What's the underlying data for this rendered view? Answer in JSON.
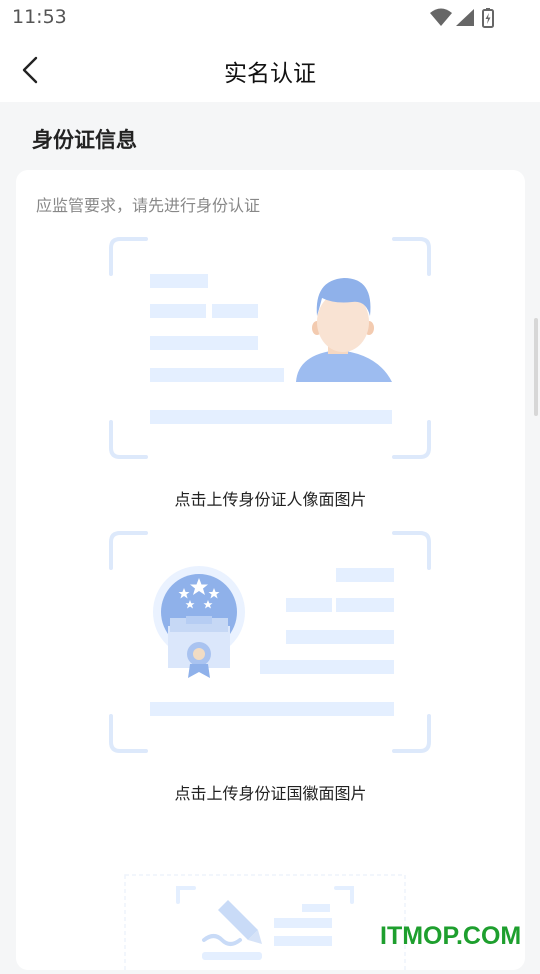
{
  "status_bar": {
    "time": "11:53",
    "icons": [
      "wifi-icon",
      "signal-icon",
      "battery-charging-icon"
    ]
  },
  "nav": {
    "title": "实名认证",
    "back_icon": "chevron-left-icon"
  },
  "section": {
    "title": "身份证信息"
  },
  "card": {
    "hint": "应监管要求，请先进行身份认证",
    "front_upload_label": "点击上传身份证人像面图片",
    "back_upload_label": "点击上传身份证国徽面图片"
  },
  "colors": {
    "accent_light": "#e4efff",
    "accent_blue": "#8fb1ea",
    "frame": "#dde9fb",
    "watermark_green": "#1e9f2e"
  },
  "watermark": "ITMOP.COM"
}
